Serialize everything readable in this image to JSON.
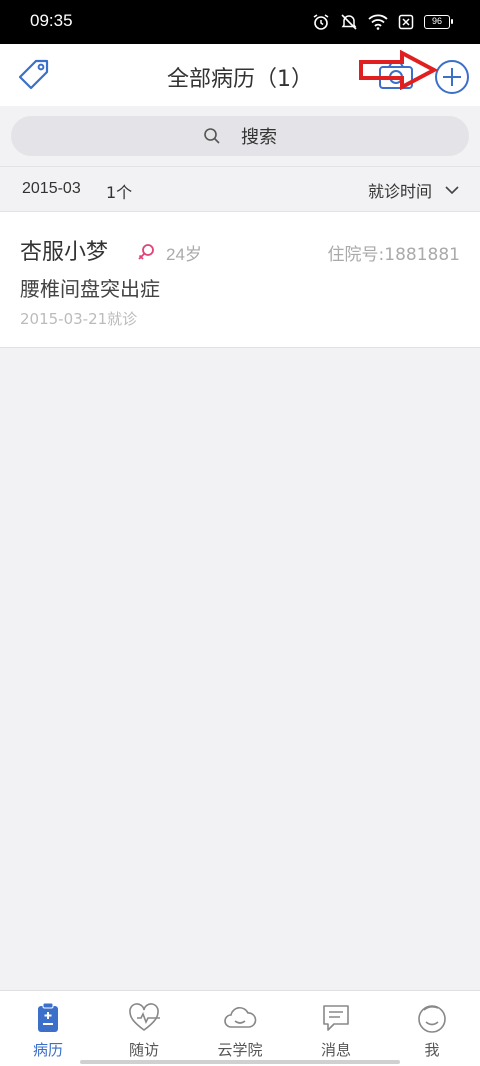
{
  "status_bar": {
    "time": "09:35",
    "battery": "96"
  },
  "header": {
    "title": "全部病历（1）"
  },
  "search": {
    "label": "搜索"
  },
  "filter": {
    "month": "2015-03",
    "count": "1个",
    "sort_label": "就诊时间"
  },
  "records": [
    {
      "name": "杏服小梦",
      "gender": "female",
      "age": "24岁",
      "hospital_no": "住院号:1881881",
      "diagnosis": "腰椎间盘突出症",
      "visit": "2015-03-21就诊"
    }
  ],
  "tabs": [
    {
      "label": "病历",
      "icon": "clipboard-icon",
      "active": true
    },
    {
      "label": "随访",
      "icon": "heart-pulse-icon",
      "active": false
    },
    {
      "label": "云学院",
      "icon": "cloud-icon",
      "active": false
    },
    {
      "label": "消息",
      "icon": "message-icon",
      "active": false
    },
    {
      "label": "我",
      "icon": "smile-face-icon",
      "active": false
    }
  ],
  "colors": {
    "accent": "#3b6fc9",
    "female": "#e0447a",
    "annotation": "#e02020"
  }
}
